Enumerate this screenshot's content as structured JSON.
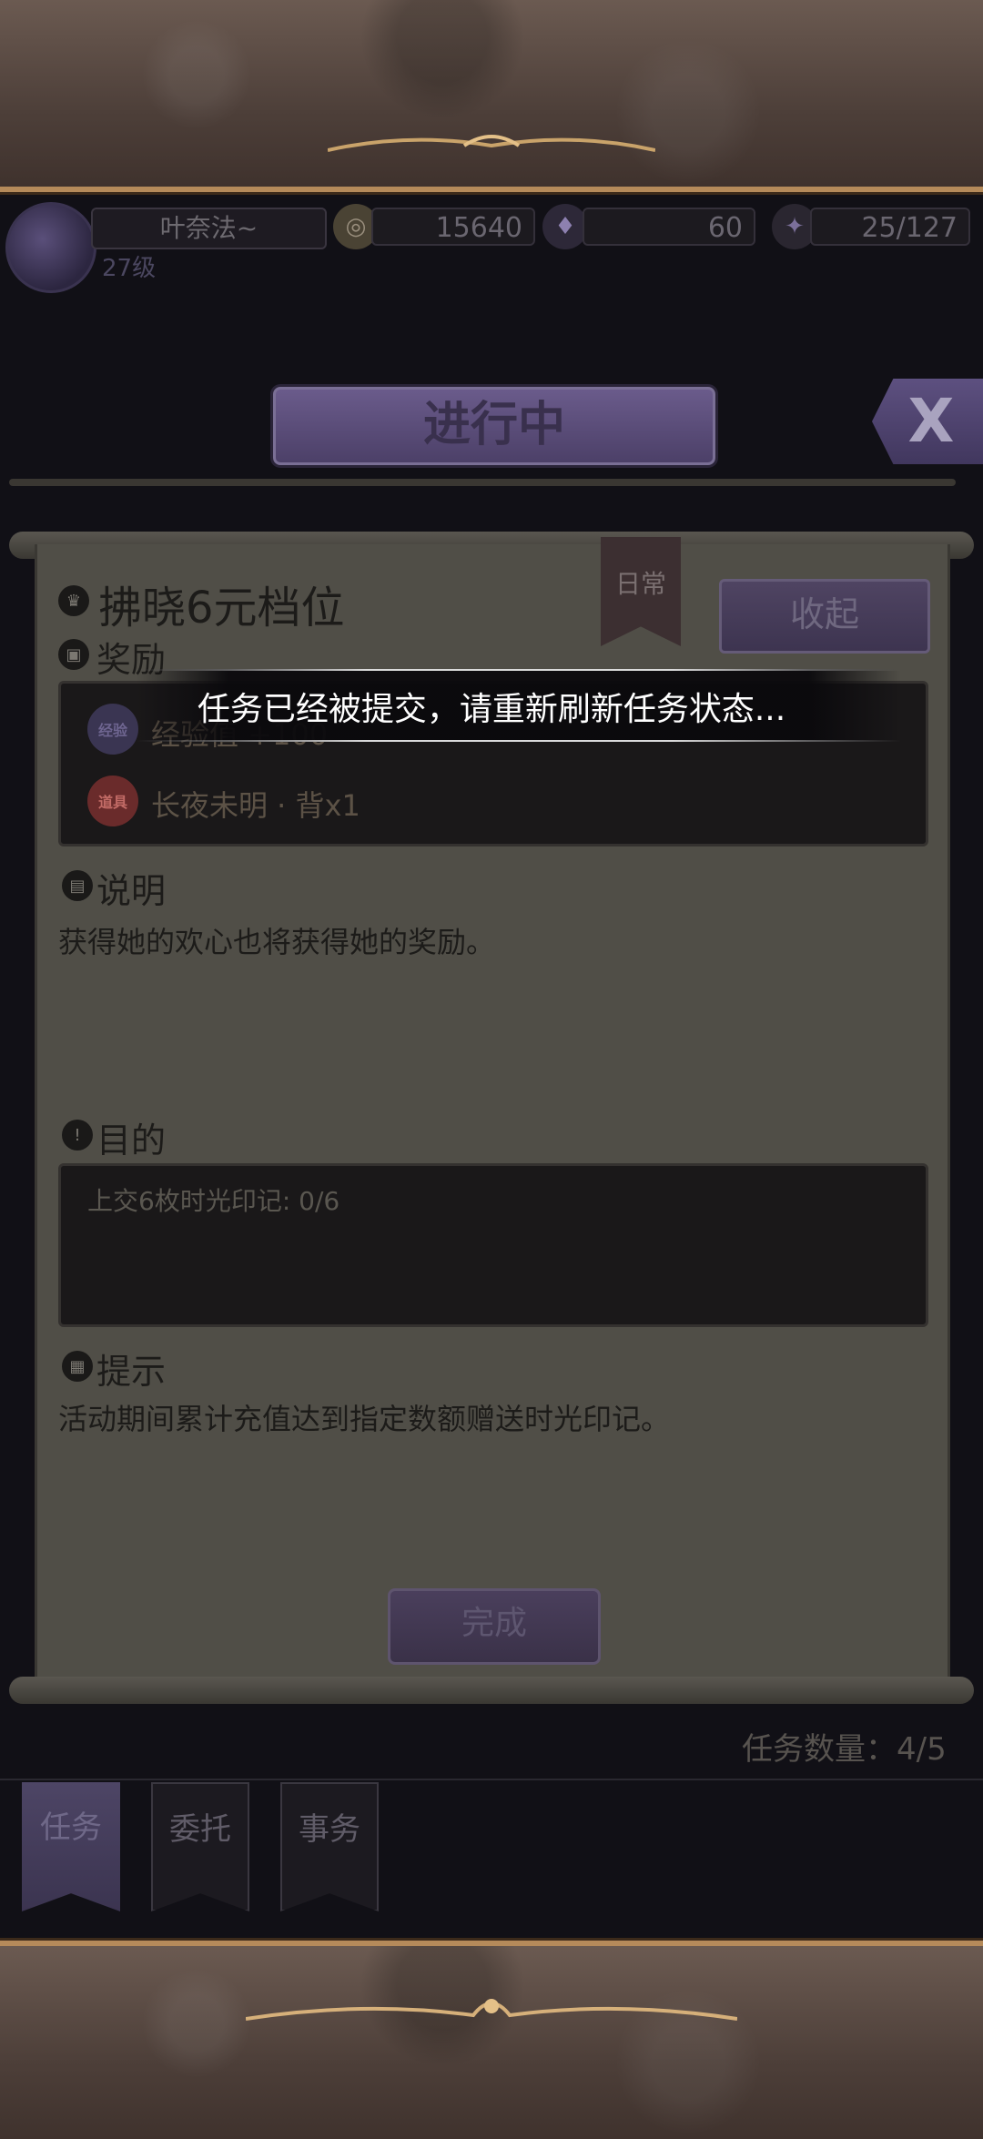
{
  "player": {
    "name": "叶奈法~",
    "level": "27级"
  },
  "resources": {
    "gold": "15640",
    "gems": "60",
    "stamina": "25/127"
  },
  "header": {
    "title": "进行中",
    "close_label": "X"
  },
  "task": {
    "badge": "日常",
    "title": "拂晓6元档位",
    "collapse_label": "收起",
    "reward_label": "奖励",
    "rewards": [
      {
        "icon_text": "经验",
        "text": "经验值 +100"
      },
      {
        "icon_text": "道具",
        "text": "长夜未明 · 背x1"
      }
    ],
    "desc_label": "说明",
    "desc_text": "获得她的欢心也将获得她的奖励。",
    "objective_label": "目的",
    "objective_text": "上交6枚时光印记: 0/6",
    "hint_label": "提示",
    "hint_text": "活动期间累计充值达到指定数额赠送时光印记。",
    "complete_label": "完成"
  },
  "task_count": "任务数量：4/5",
  "tabs": [
    {
      "label": "任务",
      "active": true
    },
    {
      "label": "委托",
      "active": false
    },
    {
      "label": "事务",
      "active": false
    }
  ],
  "toast": {
    "text": "任务已经被提交，请重新刷新任务状态..."
  },
  "colors": {
    "accent_purple": "#5d5080",
    "panel": "#504e47",
    "frame": "#5a4a42"
  }
}
